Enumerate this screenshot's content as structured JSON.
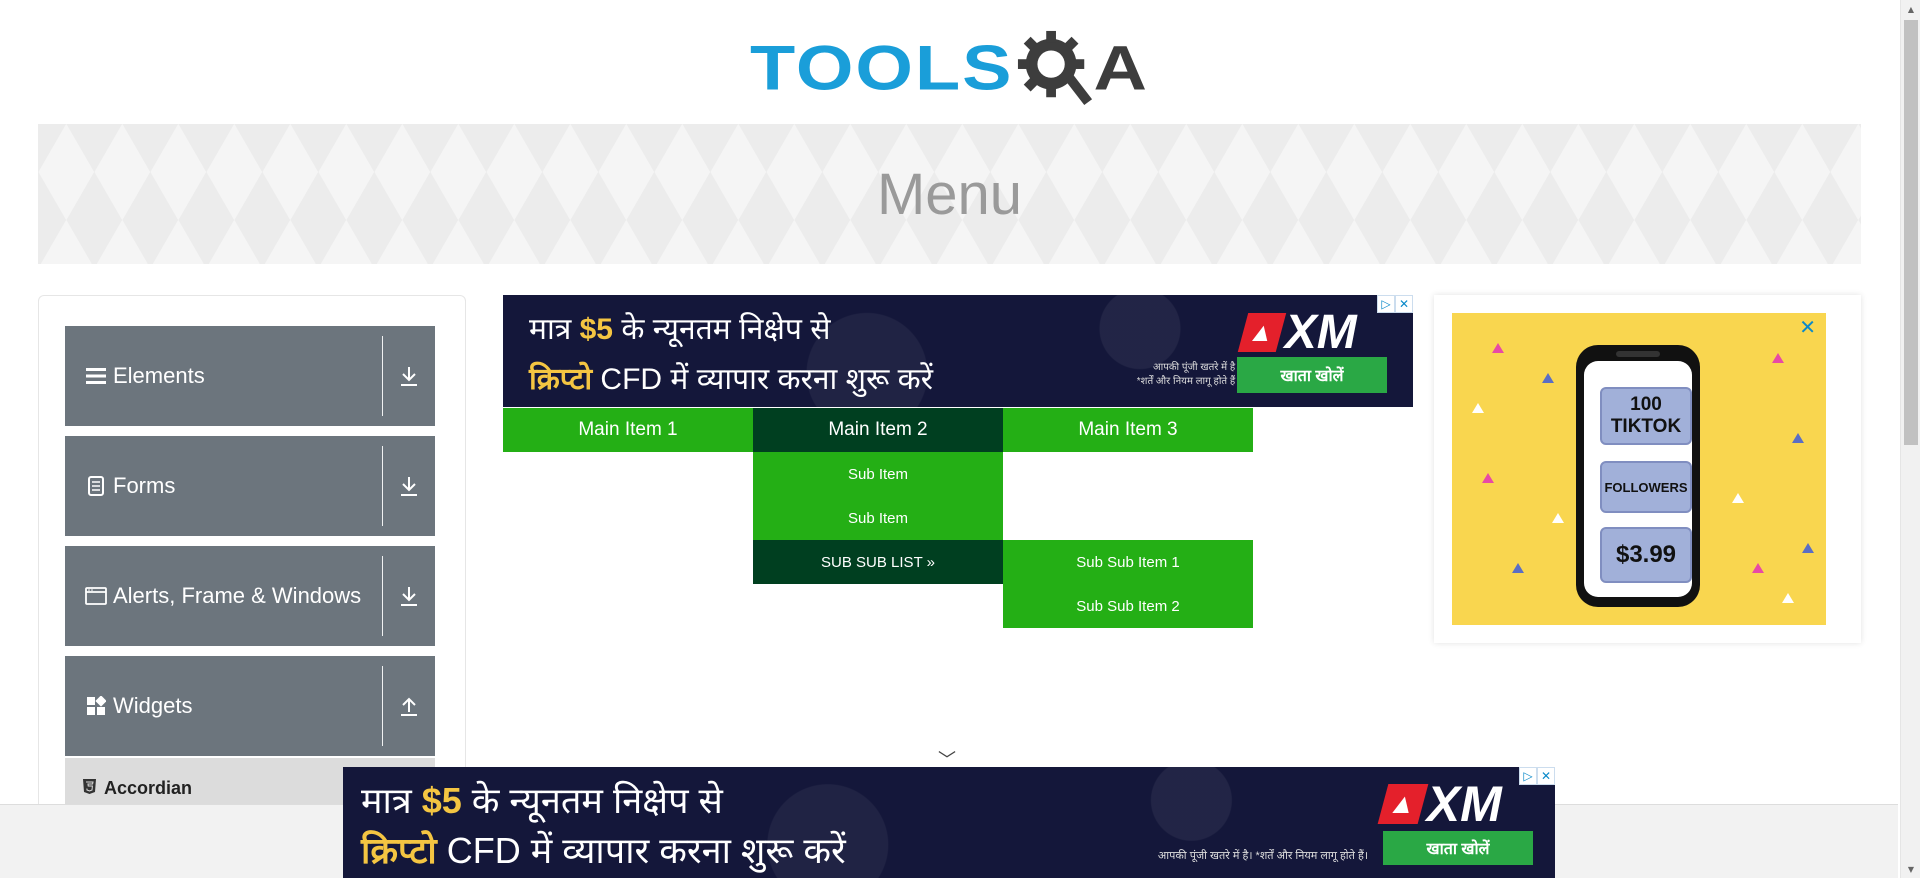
{
  "header": {
    "logo_text_left": "TOOLS",
    "logo_text_right": "A"
  },
  "banner": {
    "title": "Menu"
  },
  "sidebar": {
    "groups": [
      {
        "label": "Elements",
        "icon": "hamburger-icon",
        "toggle_icon": "download-arrow-icon"
      },
      {
        "label": "Forms",
        "icon": "document-icon",
        "toggle_icon": "download-arrow-icon"
      },
      {
        "label": "Alerts, Frame & Windows",
        "icon": "window-icon",
        "toggle_icon": "download-arrow-icon"
      },
      {
        "label": "Widgets",
        "icon": "widgets-icon",
        "toggle_icon": "upload-arrow-icon"
      }
    ],
    "active_subitem": {
      "label": "Accordian",
      "icon": "html5-icon"
    }
  },
  "top_ad": {
    "line1_prefix": "मात्र ",
    "line1_amount": "$5",
    "line1_suffix": " के न्यूनतम निक्षेप से",
    "line2_highlight": "क्रिप्टो",
    "line2_rest": " CFD में  व्यापार करना शुरू करें",
    "brand": "XM",
    "disclaimer_line1": "आपकी पूंजी खतरे में है।",
    "disclaimer_line2": "*शर्तें और नियम लागू होते हैं।",
    "cta": "खाता खोलें"
  },
  "bottom_ad": {
    "disclaimer": "आपकी पूंजी खतरे में है। *शर्तें और नियम लागू होते हैं।"
  },
  "menu": {
    "main_items": [
      "Main Item 1",
      "Main Item 2",
      "Main Item 3"
    ],
    "sub_items": [
      "Sub Item",
      "Sub Item",
      "SUB SUB LIST »"
    ],
    "sub_sub_items": [
      "Sub Sub Item 1",
      "Sub Sub Item 2"
    ],
    "colors": {
      "item_bg": "#24af15",
      "active_bg": "#003f20"
    }
  },
  "right_ad": {
    "tile1_line1": "100",
    "tile1_line2": "TIKTOK",
    "tile2": "FOLLOWERS",
    "tile3": "$3.99",
    "close": "✕"
  },
  "ad_controls": {
    "info": "▷",
    "close": "✕"
  },
  "chevron": "﹀"
}
